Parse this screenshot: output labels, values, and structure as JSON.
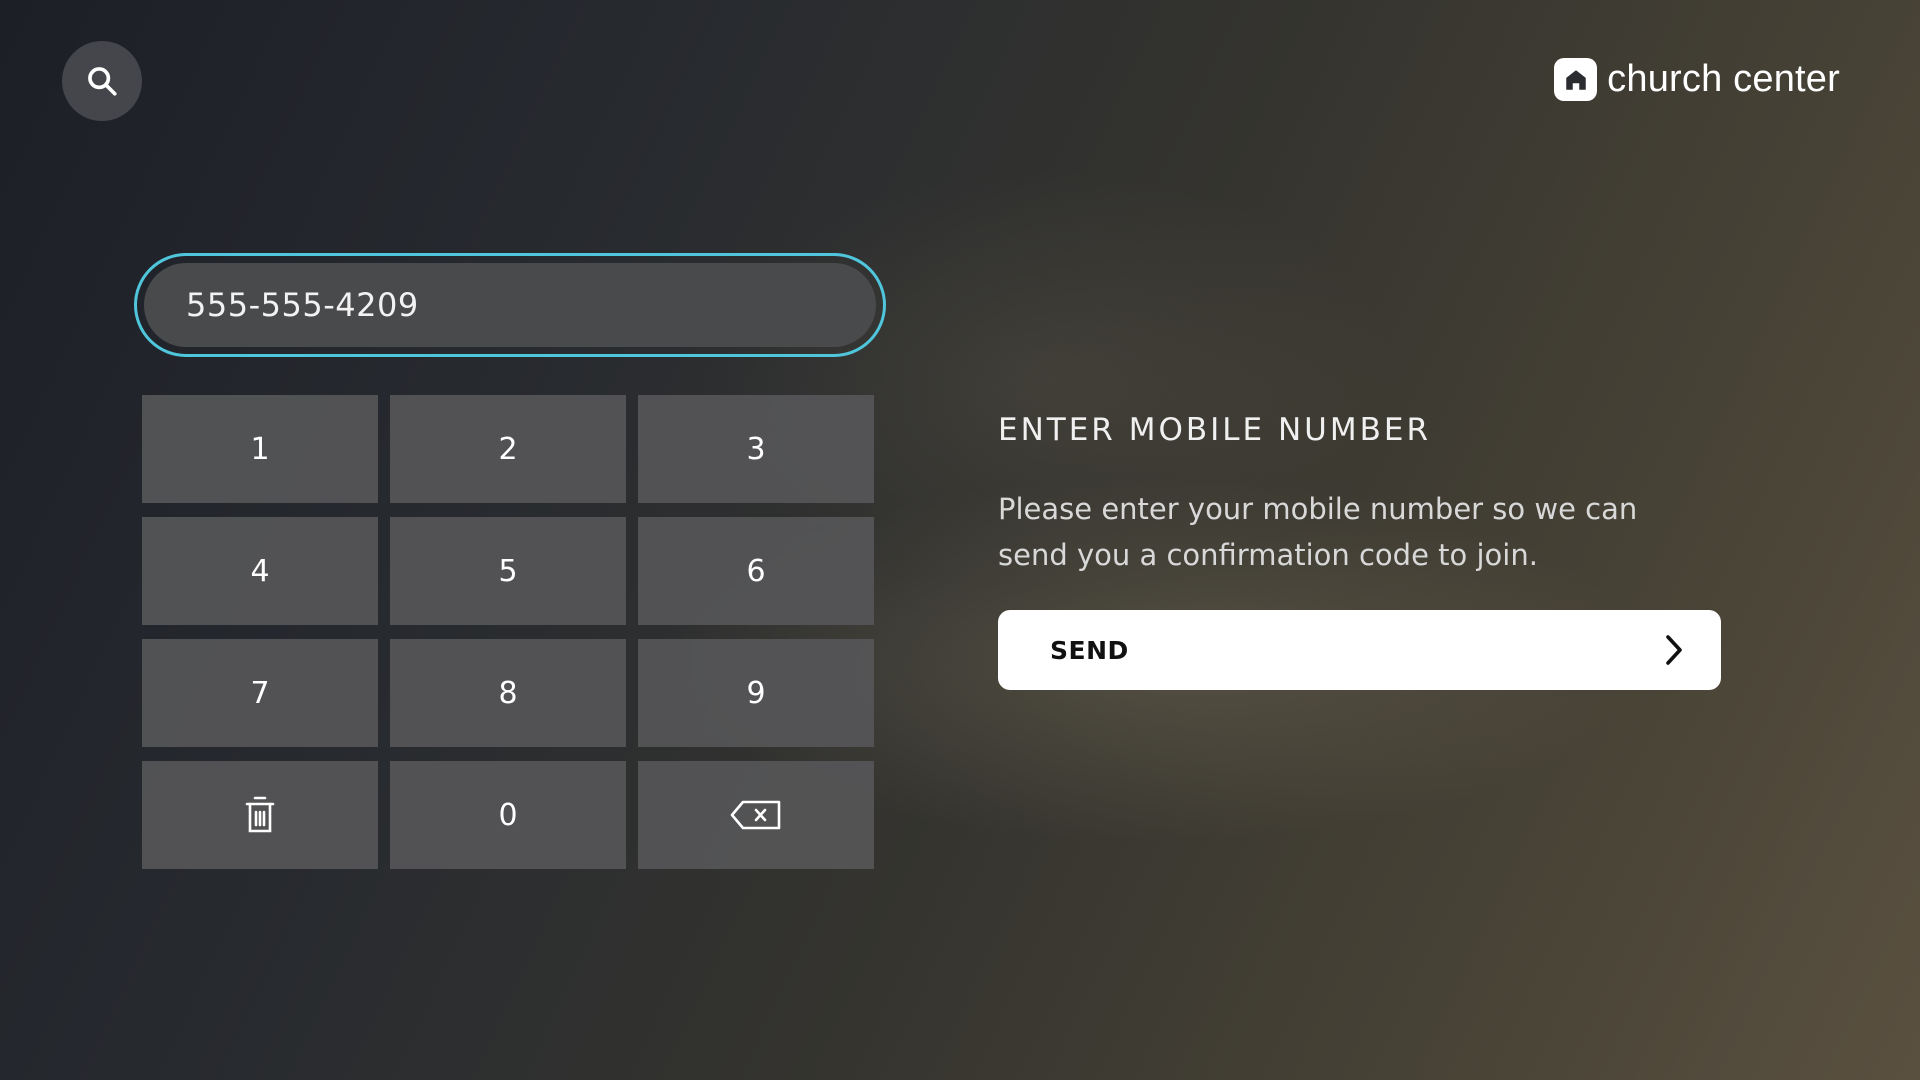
{
  "header": {
    "search_icon": "search-icon",
    "brand": {
      "name": "church center",
      "icon": "home-icon"
    }
  },
  "phone_input": {
    "value": "555-555-4209"
  },
  "keypad": {
    "keys": [
      "1",
      "2",
      "3",
      "4",
      "5",
      "6",
      "7",
      "8",
      "9",
      "0"
    ],
    "clear_icon": "trash-icon",
    "backspace_icon": "backspace-icon"
  },
  "prompt": {
    "title": "ENTER MOBILE NUMBER",
    "description": "Please enter your mobile number so we can send you a confirmation code to join."
  },
  "send_button": {
    "label": "SEND",
    "icon": "chevron-right-icon"
  },
  "colors": {
    "focus_ring": "#4fc6dc",
    "key_bg": "#565658",
    "button_bg": "#ffffff"
  }
}
